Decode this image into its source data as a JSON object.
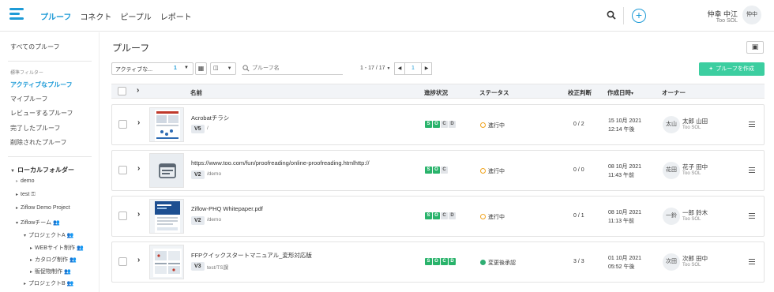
{
  "nav": {
    "items": [
      {
        "label": "プルーフ",
        "active": true
      },
      {
        "label": "コネクト",
        "active": false
      },
      {
        "label": "ピープル",
        "active": false
      },
      {
        "label": "レポート",
        "active": false
      }
    ],
    "add_symbol": "+"
  },
  "user": {
    "name": "仲幸 中江",
    "org": "Too SOL",
    "initials": "仲中"
  },
  "sidebar": {
    "all_proofs": "すべてのプルーフ",
    "standard_filters_caption": "標準フィルター",
    "filters": [
      {
        "label": "アクティブなプルーフ",
        "active": true
      },
      {
        "label": "マイプルーフ",
        "active": false
      },
      {
        "label": "レビューするプルーフ",
        "active": false
      },
      {
        "label": "完了したプルーフ",
        "active": false
      },
      {
        "label": "削除されたプルーフ",
        "active": false
      }
    ],
    "local_folders_label": "ローカルフォルダー",
    "tree": [
      "demo",
      "test",
      "Ziflow Demo Project",
      "Ziflowチーム",
      "プロジェクトA",
      "WEBサイト制作",
      "カタログ制作",
      "販促物制作",
      "プロジェクトB"
    ]
  },
  "main": {
    "title": "プルーフ",
    "filter_label": "アクティブな...",
    "filter_count": "1",
    "search_placeholder": "プルーフ名",
    "pager_text": "1 - 17 / 17",
    "page_number": "1",
    "create_button": "プルーフを作成"
  },
  "table": {
    "headers": {
      "name": "名前",
      "progress": "進捗状況",
      "status": "ステータス",
      "proof": "校正判断",
      "created": "作成日時",
      "owner": "オーナー"
    },
    "rows": [
      {
        "name": "Acrobatチラシ",
        "version": "V5",
        "path": "/",
        "stages": [
          [
            "S",
            "g"
          ],
          [
            "O",
            "g"
          ],
          [
            "C",
            "l"
          ],
          [
            "D",
            "l"
          ]
        ],
        "status": "進行中",
        "status_type": "wait",
        "proof": "0 / 2",
        "date1": "15 10月 2021",
        "date2": "12:14 午後",
        "owner_initials": "太山",
        "owner_name": "太郎 山田",
        "owner_org": "Too SOL"
      },
      {
        "name": "https://www.too.com/fun/proofreading/online-proofreading.htmlhttp://",
        "version": "V2",
        "path": "/demo",
        "stages": [
          [
            "S",
            "g"
          ],
          [
            "O",
            "g"
          ],
          [
            "C",
            "l"
          ]
        ],
        "status": "進行中",
        "status_type": "wait",
        "proof": "0 / 0",
        "date1": "08 10月 2021",
        "date2": "11:43 午前",
        "owner_initials": "花田",
        "owner_name": "花子 田中",
        "owner_org": "Too SOL"
      },
      {
        "name": "Ziflow-PHQ Whitepaper.pdf",
        "version": "V2",
        "path": "/demo",
        "stages": [
          [
            "S",
            "g"
          ],
          [
            "O",
            "g"
          ],
          [
            "C",
            "l"
          ],
          [
            "D",
            "l"
          ]
        ],
        "status": "進行中",
        "status_type": "wait",
        "proof": "0 / 1",
        "date1": "08 10月 2021",
        "date2": "11:13 午前",
        "owner_initials": "一鈴",
        "owner_name": "一郎 鈴木",
        "owner_org": "Too SOL"
      },
      {
        "name": "FFPクイックスタートマニュアル_変形対応版",
        "version": "V3",
        "path": "test/TS課",
        "stages": [
          [
            "S",
            "g"
          ],
          [
            "O",
            "g"
          ],
          [
            "C",
            "g"
          ],
          [
            "D",
            "g"
          ]
        ],
        "status": "変更後承認",
        "status_type": "ok",
        "proof": "3 / 3",
        "date1": "01 10月 2021",
        "date2": "05:52 午後",
        "owner_initials": "次田",
        "owner_name": "次郎 田中",
        "owner_org": "Too SOL"
      }
    ]
  }
}
